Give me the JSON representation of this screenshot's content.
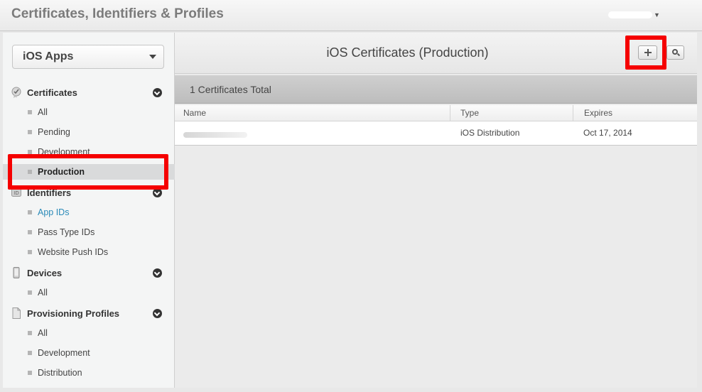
{
  "header": {
    "title": "Certificates, Identifiers & Profiles"
  },
  "sidebar": {
    "platform": "iOS Apps",
    "sections": {
      "certificates": {
        "label": "Certificates",
        "items": [
          "All",
          "Pending",
          "Development",
          "Production"
        ]
      },
      "identifiers": {
        "label": "Identifiers",
        "items": [
          "App IDs",
          "Pass Type IDs",
          "Website Push IDs"
        ]
      },
      "devices": {
        "label": "Devices",
        "items": [
          "All"
        ]
      },
      "profiles": {
        "label": "Provisioning Profiles",
        "items": [
          "All",
          "Development",
          "Distribution"
        ]
      }
    },
    "selected": "Production"
  },
  "main": {
    "title": "iOS Certificates (Production)",
    "summary": "1 Certificates Total",
    "columns": [
      "Name",
      "Type",
      "Expires"
    ],
    "rows": [
      {
        "type": "iOS Distribution",
        "expires": "Oct 17, 2014"
      }
    ]
  },
  "colors": {
    "highlight": "#f50000",
    "link": "#2a8ab8"
  },
  "icons": [
    "certificate-icon",
    "id-icon",
    "device-icon",
    "document-icon",
    "plus-icon",
    "search-icon"
  ]
}
